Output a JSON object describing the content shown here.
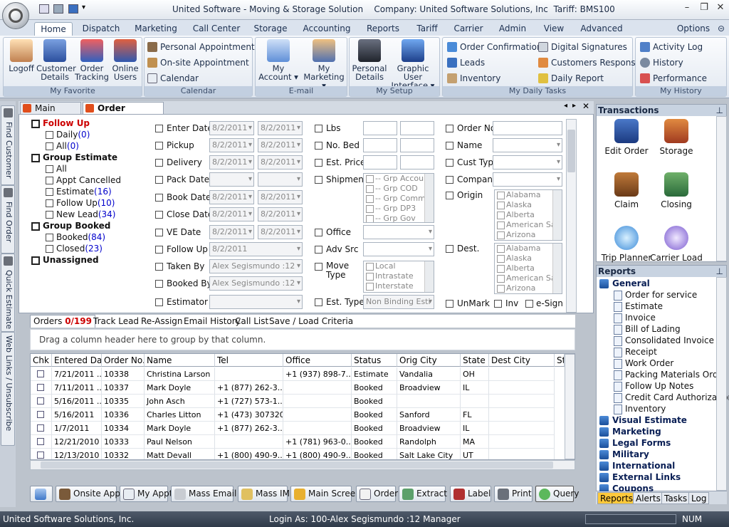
{
  "title": {
    "app": "United Software - Moving & Storage Solution",
    "company": "Company: United Software Solutions, Inc",
    "tariff": "Tariff: BMS100"
  },
  "ribbon_tabs": [
    "Home",
    "Dispatch",
    "Marketing",
    "Call Center",
    "Storage",
    "Accounting",
    "Reports",
    "Tariff",
    "Carrier",
    "Admin",
    "View",
    "Advanced"
  ],
  "options_label": "Options",
  "groups": {
    "favorite": {
      "caption": "My Favorite",
      "buttons": [
        "Logoff",
        "Customer Details",
        "Order Tracking",
        "Online Users"
      ]
    },
    "calendar": {
      "caption": "Calendar",
      "items": [
        "Personal Appointments",
        "On-site Appointment",
        "Calendar"
      ]
    },
    "email": {
      "caption": "E-mail",
      "buttons": [
        "My Account",
        "My Marketing"
      ]
    },
    "setup": {
      "caption": "My Setup",
      "buttons": [
        "Personal Details",
        "Graphic User Interface"
      ]
    },
    "daily": {
      "caption": "My Daily Tasks",
      "items": [
        "Order Confirmation",
        "Leads",
        "Inventory",
        "Digital Signatures",
        "Customers Response",
        "Daily Report"
      ]
    },
    "history": {
      "caption": "My History",
      "items": [
        "Activity Log",
        "History",
        "Performance"
      ]
    }
  },
  "vtabs": [
    "Find Customer",
    "Find Order",
    "Quick Estimate",
    "Web Links / Unsubscribe"
  ],
  "doc_tabs": [
    "Main Screen",
    "Order Tracking"
  ],
  "tree": {
    "follow_up": "Follow Up",
    "daily": "Daily",
    "daily_count": "(0)",
    "all": "All",
    "all_count": "(0)",
    "group_estimate": "Group Estimate",
    "ge_all": "All",
    "appt_cancelled": "Appt Cancelled",
    "estimate": "Estimate",
    "estimate_count": "(16)",
    "follow_up2": "Follow Up",
    "follow_up2_count": "(10)",
    "new_lead": "New Lead",
    "new_lead_count": "(34)",
    "group_booked": "Group Booked",
    "booked": "Booked",
    "booked_count": "(84)",
    "closed": "Closed",
    "closed_count": "(23)",
    "unassigned": "Unassigned"
  },
  "filters": {
    "enter_date": "Enter Date",
    "pickup": "Pickup",
    "delivery": "Delivery",
    "pack_date": "Pack Date",
    "book_date": "Book Date",
    "close_date": "Close Date",
    "ve_date": "VE Date",
    "follow_up": "Follow Up",
    "taken_by": "Taken By",
    "booked_by": "Booked By",
    "estimator": "Estimator",
    "date_value": "8/2/2011",
    "agent_value": "Alex Segismundo :12",
    "lbs": "Lbs",
    "no_bed": "No. Bed",
    "est_price": "Est. Price",
    "shipment": "Shipment",
    "office": "Office",
    "adv_src": "Adv Src",
    "move_type": "Move Type",
    "est_type": "Est. Type",
    "est_type_value": "Non Binding Esti",
    "shipment_options": [
      "-- Grp Accou",
      "-- Grp COD",
      "-- Grp Comme",
      "-- Grp DP3",
      "-- Grp Gov"
    ],
    "move_options": [
      "Local",
      "Intrastate",
      "Interstate"
    ],
    "order_no": "Order No.",
    "name": "Name",
    "cust_type": "Cust Type",
    "company": "Company",
    "origin": "Origin",
    "dest": "Dest.",
    "unmark": "UnMark",
    "inv": "Inv",
    "esign": "e-Sign",
    "states": [
      "Alabama",
      "Alaska",
      "Alberta",
      "American Sa",
      "Arizona"
    ]
  },
  "grid_tabs": {
    "orders_label": "Orders",
    "orders_count": "0/199",
    "others": [
      "Track Lead",
      "Re-Assign",
      "Email History",
      "Call List",
      "Save / Load Criteria"
    ]
  },
  "group_hint": "Drag a column header here to group by that column.",
  "columns": [
    "Chk",
    "Entered Date",
    "Order No.",
    "Name",
    "Tel",
    "Office",
    "Status",
    "Orig City",
    "State",
    "Dest City",
    "St"
  ],
  "rows": [
    {
      "date": "7/21/2011 ...",
      "order": "10338",
      "name": "Christina Larson",
      "tel": "",
      "office": "+1 (937) 898-7...",
      "status": "Estimate",
      "orig": "Vandalia",
      "state": "OH",
      "dest": ""
    },
    {
      "date": "7/11/2011 ...",
      "order": "10337",
      "name": "Mark Doyle",
      "tel": "+1 (877) 262-3...",
      "office": "",
      "status": "Booked",
      "orig": "Broadview",
      "state": "IL",
      "dest": ""
    },
    {
      "date": "5/16/2011 ...",
      "order": "10335",
      "name": "John Asch",
      "tel": "+1 (727) 573-1...",
      "office": "",
      "status": "Booked",
      "orig": "",
      "state": "",
      "dest": ""
    },
    {
      "date": "5/16/2011",
      "order": "10336",
      "name": "Charles Litton",
      "tel": "+1 (473) 307320",
      "office": "",
      "status": "Booked",
      "orig": "Sanford",
      "state": "FL",
      "dest": ""
    },
    {
      "date": "1/7/2011",
      "order": "10334",
      "name": "Mark Doyle",
      "tel": "+1 (877) 262-3...",
      "office": "",
      "status": "Booked",
      "orig": "Broadview",
      "state": "IL",
      "dest": ""
    },
    {
      "date": "12/21/2010",
      "order": "10333",
      "name": "Paul Nelson",
      "tel": "",
      "office": "+1 (781) 963-0...",
      "status": "Booked",
      "orig": "Randolph",
      "state": "MA",
      "dest": ""
    },
    {
      "date": "12/13/2010",
      "order": "10332",
      "name": "Matt Devall",
      "tel": "+1 (800) 490-9...",
      "office": "+1 (800) 490-9...",
      "status": "Booked",
      "orig": "Salt Lake City",
      "state": "UT",
      "dest": ""
    }
  ],
  "toolbar": [
    "Onsite Appt",
    "My Appt.",
    "Mass Email",
    "Mass IM",
    "Main Screen",
    "Order",
    "Extract",
    "Label",
    "Print",
    "Query"
  ],
  "transactions": {
    "title": "Transactions",
    "items": [
      "Edit Order",
      "Storage",
      "Claim",
      "Closing",
      "Trip Planner",
      "Carrier Load"
    ]
  },
  "reports": {
    "title": "Reports",
    "general": "General",
    "items": [
      "Order for service",
      "Estimate",
      "Invoice",
      "Bill of Lading",
      "Consolidated Invoice",
      "Receipt",
      "Work Order",
      "Packing Materials Order",
      "Follow Up Notes",
      "Credit Card Authorization",
      "Inventory"
    ],
    "categories": [
      "Visual Estimate",
      "Marketing",
      "Legal Forms",
      "Military",
      "International",
      "External Links",
      "Coupons"
    ]
  },
  "right_tabs": [
    "Reports",
    "Alerts",
    "Tasks",
    "Log"
  ],
  "status": {
    "company": "United Software Solutions, Inc.",
    "login": "Login As: 100-Alex Segismundo :12  Manager",
    "num": "NUM"
  }
}
